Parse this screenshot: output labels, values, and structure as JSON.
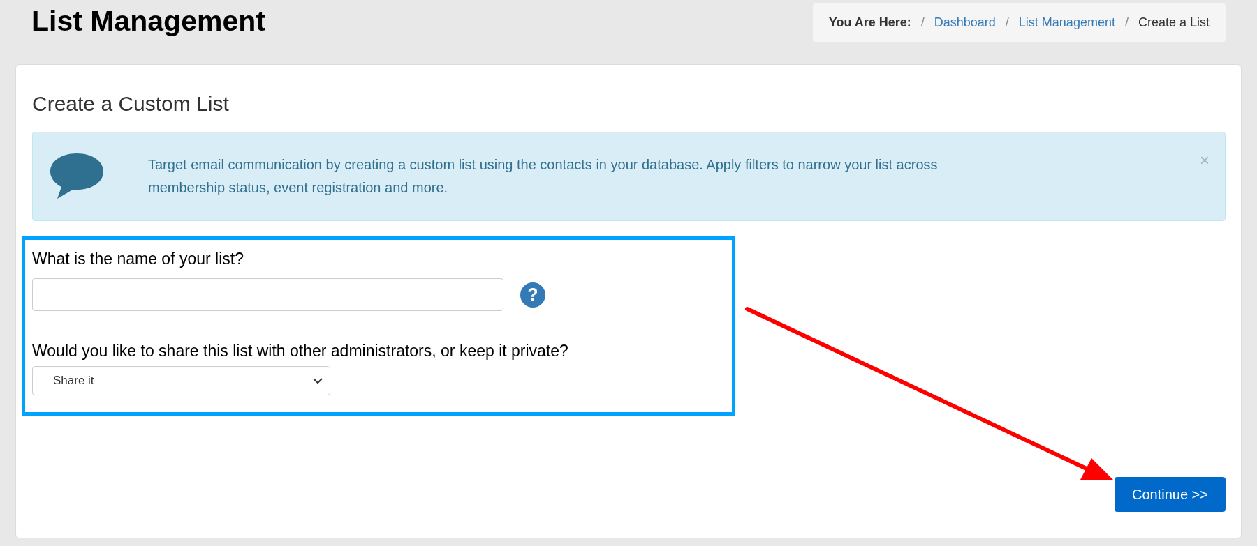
{
  "page_title": "List Management",
  "breadcrumb": {
    "label": "You Are Here:",
    "items": [
      {
        "separator": "/",
        "text": "Dashboard",
        "kind": "link"
      },
      {
        "separator": "/",
        "text": "List Management",
        "kind": "link"
      },
      {
        "separator": "/",
        "text": "Create a List",
        "kind": "current"
      }
    ]
  },
  "card": {
    "title": "Create a Custom List",
    "alert": {
      "text": "Target email communication by creating a custom list using the contacts in your database. Apply filters to narrow your list across membership status, event registration and more.",
      "close": "×"
    },
    "name_field": {
      "label": "What is the name of your list?",
      "help": "?"
    },
    "share_field": {
      "label": "Would you like to share this list with other administrators, or keep it private?",
      "value": "Share it"
    },
    "button": "Continue >>"
  }
}
